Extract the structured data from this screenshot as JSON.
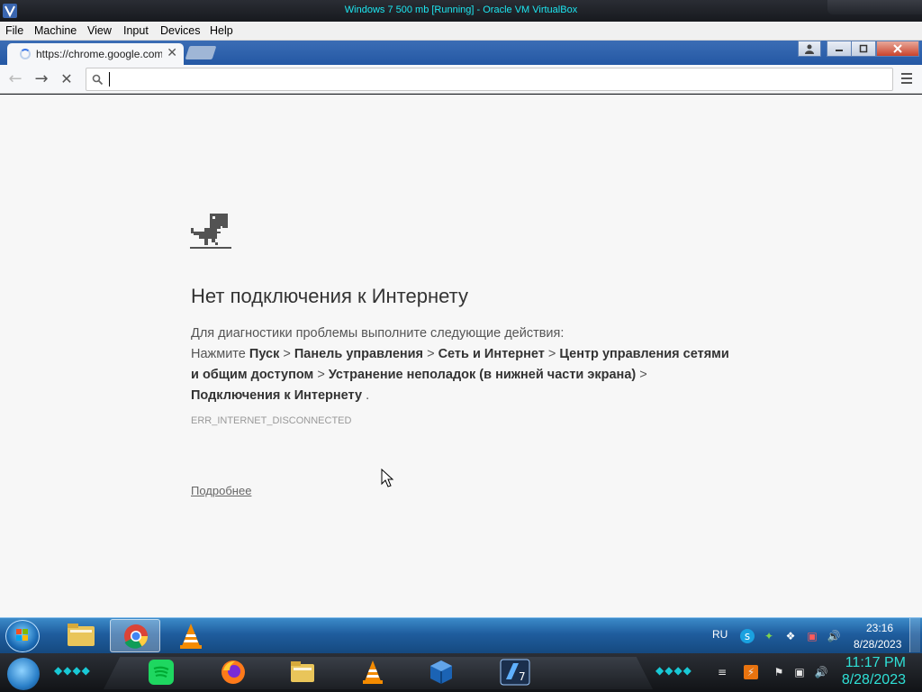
{
  "host_window": {
    "title": "Windows 7 500 mb [Running] - Oracle VM VirtualBox",
    "menu": [
      "File",
      "Machine",
      "View",
      "Input",
      "Devices",
      "Help"
    ]
  },
  "browser": {
    "tab": {
      "title": "https://chrome.google.com",
      "close_glyph": "✕"
    },
    "window_controls": [
      "user-icon",
      "minimize-icon",
      "maximize-icon",
      "close-icon"
    ],
    "toolbar": {
      "back_glyph": "←",
      "forward_glyph": "→",
      "stop_glyph": "✕",
      "search_glyph": "🔍",
      "omnibox_value": ""
    }
  },
  "error_page": {
    "title": "Нет подключения к Интернету",
    "intro": "Для диагностики проблемы выполните следующие действия:",
    "steps": {
      "press": "Нажмите",
      "start": "Пуск",
      "sep": ">",
      "control_panel": "Панель управления",
      "network": "Сеть и Интернет",
      "center": "Центр управления сетями и общим доступом",
      "troubleshoot": "Устранение неполадок (в нижней части экрана)",
      "connections": "Подключения к Интернету",
      "end": "."
    },
    "code": "ERR_INTERNET_DISCONNECTED",
    "more_link": "Подробнее"
  },
  "guest_taskbar": {
    "pinned": [
      "folder-icon",
      "chrome-icon",
      "vlc-icon"
    ],
    "language": "RU",
    "time": "23:16",
    "date": "8/28/2023"
  },
  "host_dock": {
    "apps": [
      "spotify-icon",
      "firefox-icon",
      "folder-icon",
      "vlc-icon",
      "virtualbox-icon",
      "windows7-vm-icon"
    ],
    "time": "11:17 PM",
    "date": "8/28/2023"
  },
  "colors": {
    "chrome_frame": "#2458a4",
    "taskbar": "#1f5d9e",
    "accent_cyan": "#2fe0d6"
  }
}
